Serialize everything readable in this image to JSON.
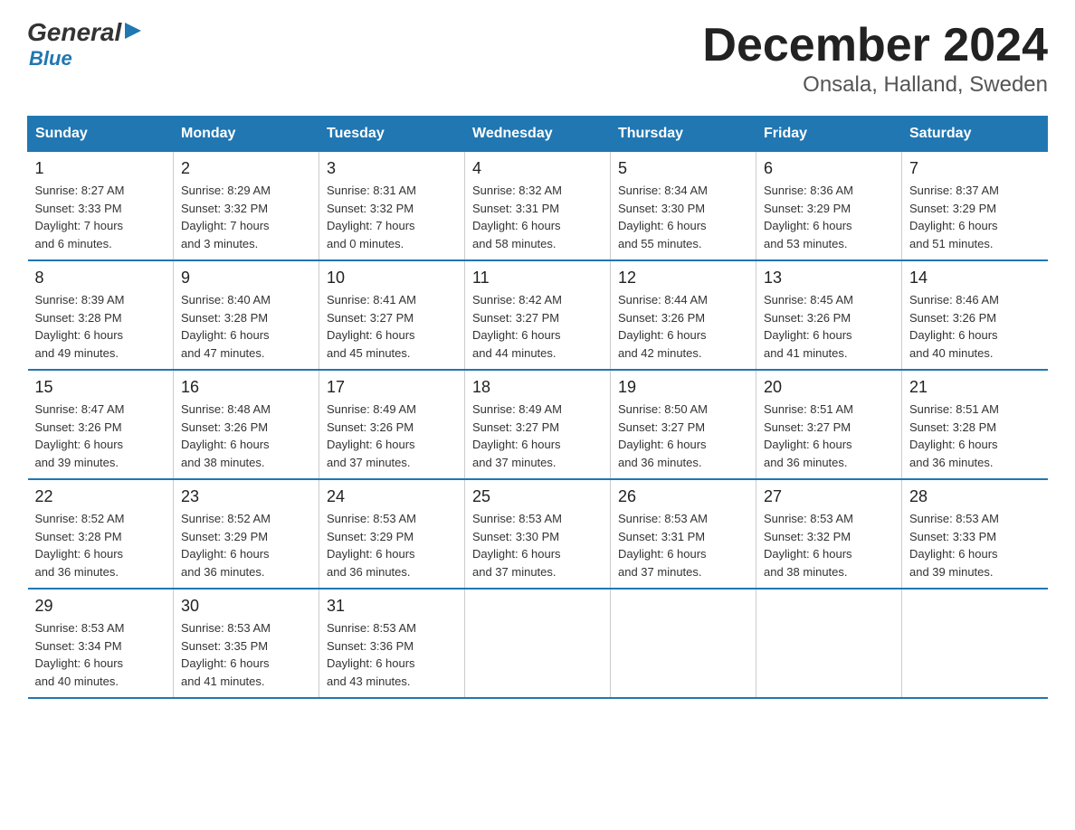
{
  "logo": {
    "general": "General",
    "blue": "Blue",
    "arrow": "▶"
  },
  "title": "December 2024",
  "subtitle": "Onsala, Halland, Sweden",
  "headers": [
    "Sunday",
    "Monday",
    "Tuesday",
    "Wednesday",
    "Thursday",
    "Friday",
    "Saturday"
  ],
  "weeks": [
    [
      {
        "day": "1",
        "info": "Sunrise: 8:27 AM\nSunset: 3:33 PM\nDaylight: 7 hours\nand 6 minutes."
      },
      {
        "day": "2",
        "info": "Sunrise: 8:29 AM\nSunset: 3:32 PM\nDaylight: 7 hours\nand 3 minutes."
      },
      {
        "day": "3",
        "info": "Sunrise: 8:31 AM\nSunset: 3:32 PM\nDaylight: 7 hours\nand 0 minutes."
      },
      {
        "day": "4",
        "info": "Sunrise: 8:32 AM\nSunset: 3:31 PM\nDaylight: 6 hours\nand 58 minutes."
      },
      {
        "day": "5",
        "info": "Sunrise: 8:34 AM\nSunset: 3:30 PM\nDaylight: 6 hours\nand 55 minutes."
      },
      {
        "day": "6",
        "info": "Sunrise: 8:36 AM\nSunset: 3:29 PM\nDaylight: 6 hours\nand 53 minutes."
      },
      {
        "day": "7",
        "info": "Sunrise: 8:37 AM\nSunset: 3:29 PM\nDaylight: 6 hours\nand 51 minutes."
      }
    ],
    [
      {
        "day": "8",
        "info": "Sunrise: 8:39 AM\nSunset: 3:28 PM\nDaylight: 6 hours\nand 49 minutes."
      },
      {
        "day": "9",
        "info": "Sunrise: 8:40 AM\nSunset: 3:28 PM\nDaylight: 6 hours\nand 47 minutes."
      },
      {
        "day": "10",
        "info": "Sunrise: 8:41 AM\nSunset: 3:27 PM\nDaylight: 6 hours\nand 45 minutes."
      },
      {
        "day": "11",
        "info": "Sunrise: 8:42 AM\nSunset: 3:27 PM\nDaylight: 6 hours\nand 44 minutes."
      },
      {
        "day": "12",
        "info": "Sunrise: 8:44 AM\nSunset: 3:26 PM\nDaylight: 6 hours\nand 42 minutes."
      },
      {
        "day": "13",
        "info": "Sunrise: 8:45 AM\nSunset: 3:26 PM\nDaylight: 6 hours\nand 41 minutes."
      },
      {
        "day": "14",
        "info": "Sunrise: 8:46 AM\nSunset: 3:26 PM\nDaylight: 6 hours\nand 40 minutes."
      }
    ],
    [
      {
        "day": "15",
        "info": "Sunrise: 8:47 AM\nSunset: 3:26 PM\nDaylight: 6 hours\nand 39 minutes."
      },
      {
        "day": "16",
        "info": "Sunrise: 8:48 AM\nSunset: 3:26 PM\nDaylight: 6 hours\nand 38 minutes."
      },
      {
        "day": "17",
        "info": "Sunrise: 8:49 AM\nSunset: 3:26 PM\nDaylight: 6 hours\nand 37 minutes."
      },
      {
        "day": "18",
        "info": "Sunrise: 8:49 AM\nSunset: 3:27 PM\nDaylight: 6 hours\nand 37 minutes."
      },
      {
        "day": "19",
        "info": "Sunrise: 8:50 AM\nSunset: 3:27 PM\nDaylight: 6 hours\nand 36 minutes."
      },
      {
        "day": "20",
        "info": "Sunrise: 8:51 AM\nSunset: 3:27 PM\nDaylight: 6 hours\nand 36 minutes."
      },
      {
        "day": "21",
        "info": "Sunrise: 8:51 AM\nSunset: 3:28 PM\nDaylight: 6 hours\nand 36 minutes."
      }
    ],
    [
      {
        "day": "22",
        "info": "Sunrise: 8:52 AM\nSunset: 3:28 PM\nDaylight: 6 hours\nand 36 minutes."
      },
      {
        "day": "23",
        "info": "Sunrise: 8:52 AM\nSunset: 3:29 PM\nDaylight: 6 hours\nand 36 minutes."
      },
      {
        "day": "24",
        "info": "Sunrise: 8:53 AM\nSunset: 3:29 PM\nDaylight: 6 hours\nand 36 minutes."
      },
      {
        "day": "25",
        "info": "Sunrise: 8:53 AM\nSunset: 3:30 PM\nDaylight: 6 hours\nand 37 minutes."
      },
      {
        "day": "26",
        "info": "Sunrise: 8:53 AM\nSunset: 3:31 PM\nDaylight: 6 hours\nand 37 minutes."
      },
      {
        "day": "27",
        "info": "Sunrise: 8:53 AM\nSunset: 3:32 PM\nDaylight: 6 hours\nand 38 minutes."
      },
      {
        "day": "28",
        "info": "Sunrise: 8:53 AM\nSunset: 3:33 PM\nDaylight: 6 hours\nand 39 minutes."
      }
    ],
    [
      {
        "day": "29",
        "info": "Sunrise: 8:53 AM\nSunset: 3:34 PM\nDaylight: 6 hours\nand 40 minutes."
      },
      {
        "day": "30",
        "info": "Sunrise: 8:53 AM\nSunset: 3:35 PM\nDaylight: 6 hours\nand 41 minutes."
      },
      {
        "day": "31",
        "info": "Sunrise: 8:53 AM\nSunset: 3:36 PM\nDaylight: 6 hours\nand 43 minutes."
      },
      {
        "day": "",
        "info": ""
      },
      {
        "day": "",
        "info": ""
      },
      {
        "day": "",
        "info": ""
      },
      {
        "day": "",
        "info": ""
      }
    ]
  ]
}
